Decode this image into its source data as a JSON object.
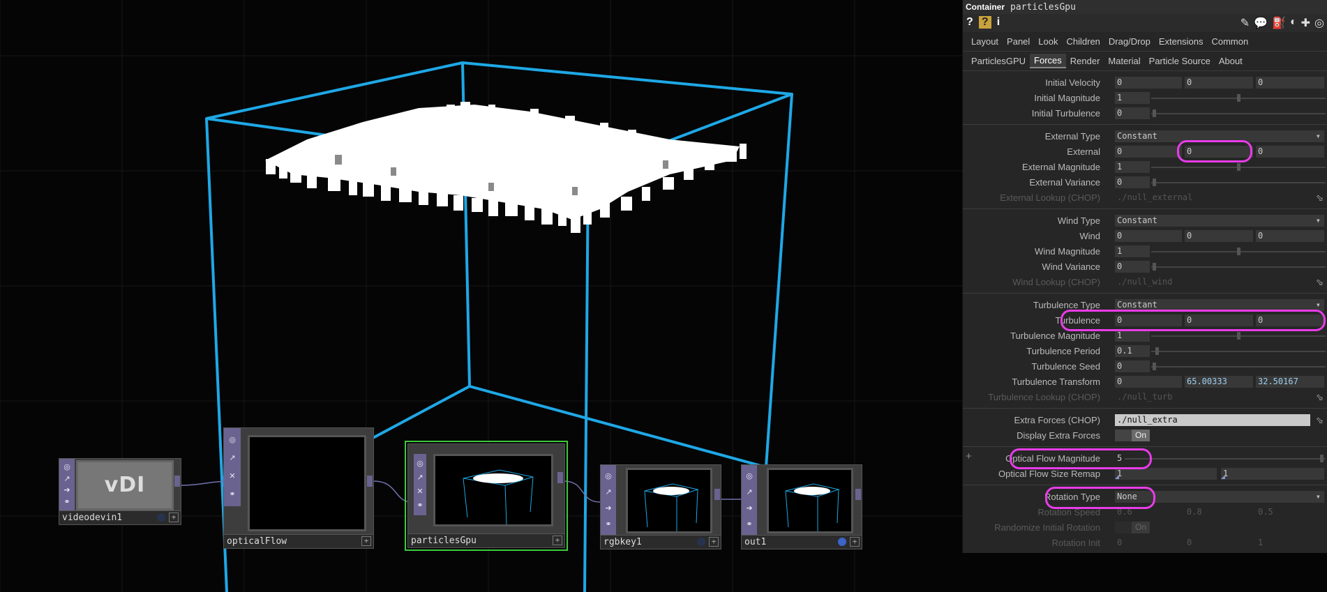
{
  "network": {
    "nodes": [
      {
        "name": "videodevin1",
        "thumb_text": "vDI"
      },
      {
        "name": "opticalFlow"
      },
      {
        "name": "particlesGpu"
      },
      {
        "name": "rgbkey1"
      },
      {
        "name": "out1"
      }
    ]
  },
  "panel": {
    "type_label": "Container",
    "node_name": "particlesGpu",
    "help_icons": [
      "?",
      "?",
      "i"
    ],
    "tabs_row1": [
      "Layout",
      "Panel",
      "Look",
      "Children",
      "Drag/Drop",
      "Extensions",
      "Common"
    ],
    "tabs_row2": [
      "ParticlesGPU",
      "Forces",
      "Render",
      "Material",
      "Particle Source",
      "About"
    ],
    "active_tab": "Forces",
    "params": {
      "initial_velocity": {
        "label": "Initial Velocity",
        "v": [
          "0",
          "0",
          "0"
        ]
      },
      "initial_magnitude": {
        "label": "Initial Magnitude",
        "v": "1"
      },
      "initial_turbulence": {
        "label": "Initial Turbulence",
        "v": "0"
      },
      "external_type": {
        "label": "External Type",
        "v": "Constant"
      },
      "external": {
        "label": "External",
        "v": [
          "0",
          "0",
          "0"
        ]
      },
      "external_magnitude": {
        "label": "External Magnitude",
        "v": "1"
      },
      "external_variance": {
        "label": "External Variance",
        "v": "0"
      },
      "external_lookup": {
        "label": "External Lookup (CHOP)",
        "v": "./null_external"
      },
      "wind_type": {
        "label": "Wind Type",
        "v": "Constant"
      },
      "wind": {
        "label": "Wind",
        "v": [
          "0",
          "0",
          "0"
        ]
      },
      "wind_magnitude": {
        "label": "Wind Magnitude",
        "v": "1"
      },
      "wind_variance": {
        "label": "Wind Variance",
        "v": "0"
      },
      "wind_lookup": {
        "label": "Wind Lookup (CHOP)",
        "v": "./null_wind"
      },
      "turbulence_type": {
        "label": "Turbulence Type",
        "v": "Constant"
      },
      "turbulence": {
        "label": "Turbulence",
        "v": [
          "0",
          "0",
          "0"
        ]
      },
      "turbulence_magnitude": {
        "label": "Turbulence Magnitude",
        "v": "1"
      },
      "turbulence_period": {
        "label": "Turbulence Period",
        "v": "0.1"
      },
      "turbulence_seed": {
        "label": "Turbulence Seed",
        "v": "0"
      },
      "turbulence_transform": {
        "label": "Turbulence Transform",
        "v": [
          "0",
          "65.00333",
          "32.50167"
        ]
      },
      "turbulence_lookup": {
        "label": "Turbulence Lookup (CHOP)",
        "v": "./null_turb"
      },
      "extra_forces": {
        "label": "Extra Forces (CHOP)",
        "v": "./null_extra"
      },
      "display_extra_forces": {
        "label": "Display Extra Forces",
        "v": "On"
      },
      "optical_flow_magnitude": {
        "label": "Optical Flow Magnitude",
        "v": "5"
      },
      "optical_flow_size_remap": {
        "label": "Optical Flow Size Remap",
        "v": [
          "1",
          "1"
        ]
      },
      "rotation_type": {
        "label": "Rotation Type",
        "v": "None"
      },
      "rotation_speed": {
        "label": "Rotation Speed",
        "v": [
          "0.6",
          "0.8",
          "0.5"
        ]
      },
      "randomize_initial_rotation": {
        "label": "Randomize Initial Rotation",
        "v": "On"
      },
      "rotation_init": {
        "label": "Rotation Init",
        "v": [
          "0",
          "0",
          "1"
        ]
      }
    }
  },
  "colors": {
    "box": "#1ea8e6",
    "highlight": "#e83ce8",
    "selected": "#3ecb3e",
    "node_strip": "#6a6390"
  }
}
